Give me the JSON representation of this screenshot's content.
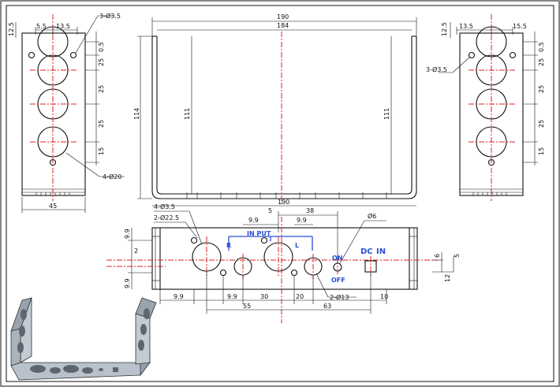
{
  "view_left": {
    "dims": {
      "top_left": "5.5",
      "top_right": "13.5",
      "holes_small": "3-Ø3.5",
      "edge_top": "12.5",
      "offset": "0.5",
      "pitch1": "25",
      "pitch2": "25",
      "pitch3": "25",
      "bottom": "15",
      "holes_large": "4-Ø20",
      "width": "45"
    }
  },
  "view_front": {
    "dims": {
      "outer_width": "190",
      "inner_width": "184",
      "height": "114",
      "inner_height_left": "111",
      "inner_height_right": "111",
      "bottom_width": "190"
    }
  },
  "view_right": {
    "dims": {
      "top_left": "13.5",
      "top_right": "15.5",
      "edge_top": "12.5",
      "holes_small": "3-Ø3.5",
      "offset": "0.5",
      "pitch1": "25",
      "pitch2": "25",
      "pitch3": "25",
      "bottom": "15"
    }
  },
  "view_bottom": {
    "dims": {
      "holes_xlr": "2-Ø22.5",
      "holes_small": "4-Ø3.5",
      "d99a": "9.9",
      "d99b": "9.9",
      "d5": "5",
      "d38": "38",
      "phi6": "Ø6",
      "left_top": "9.9",
      "left_2": "2",
      "left_bottom": "9.9",
      "right_6": "6",
      "right_5": "5",
      "right_12": "12",
      "b99a": "9.9",
      "b99b": "9.9",
      "b30": "30",
      "b20": "20",
      "holes_13": "2-Ø13",
      "b10": "10",
      "b55": "55",
      "b63": "63"
    },
    "labels": {
      "input": "IN PUT",
      "r": "R",
      "l": "L",
      "on": "ON",
      "off": "OFF",
      "dc": "DC",
      "in": "IN"
    }
  },
  "colors": {
    "centerline": "#d22222",
    "annotation": "#2a4fd6",
    "iso_face": "#b9c2cc"
  }
}
